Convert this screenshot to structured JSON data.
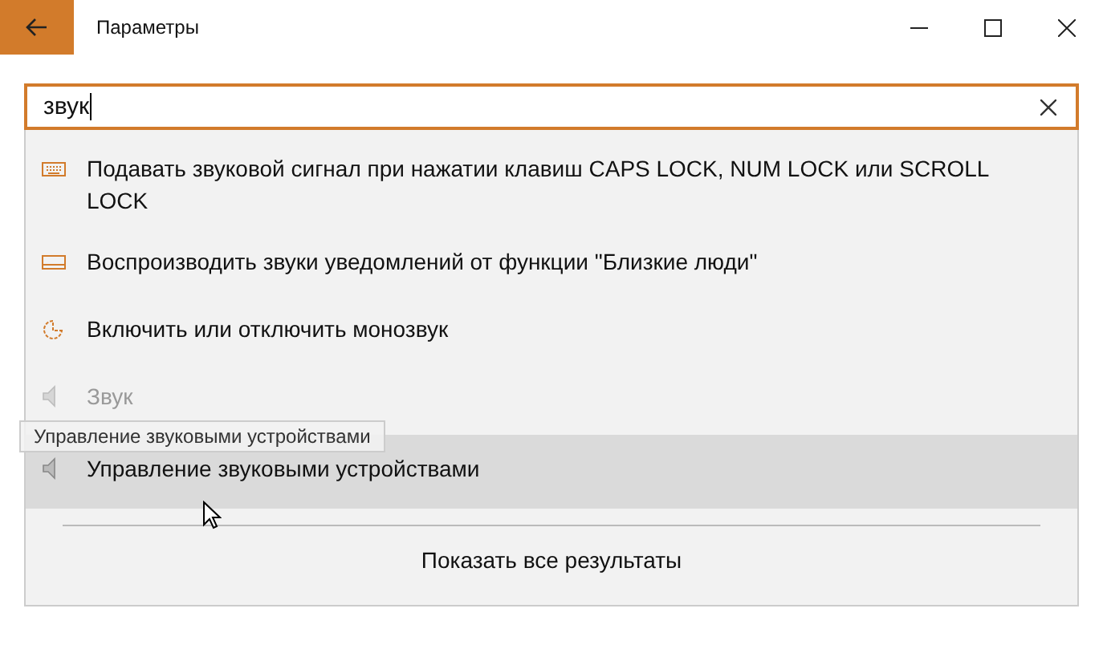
{
  "window": {
    "title": "Параметры"
  },
  "search": {
    "value": "звук"
  },
  "results": [
    {
      "kind": "keyboard",
      "label": "Подавать звуковой сигнал при нажатии клавиш CAPS LOCK, NUM LOCK или SCROLL LOCK",
      "selected": false,
      "dimmed": false
    },
    {
      "kind": "panel",
      "label": "Воспроизводить звуки уведомлений от функции \"Близкие люди\"",
      "selected": false,
      "dimmed": false
    },
    {
      "kind": "dial",
      "label": "Включить или отключить монозвук",
      "selected": false,
      "dimmed": false
    },
    {
      "kind": "speaker",
      "label": "Звук",
      "selected": false,
      "dimmed": true
    },
    {
      "kind": "speaker",
      "label": "Управление звуковыми устройствами",
      "selected": true,
      "dimmed": false
    }
  ],
  "tooltip": "Управление звуковыми устройствами",
  "show_all": "Показать все результаты"
}
